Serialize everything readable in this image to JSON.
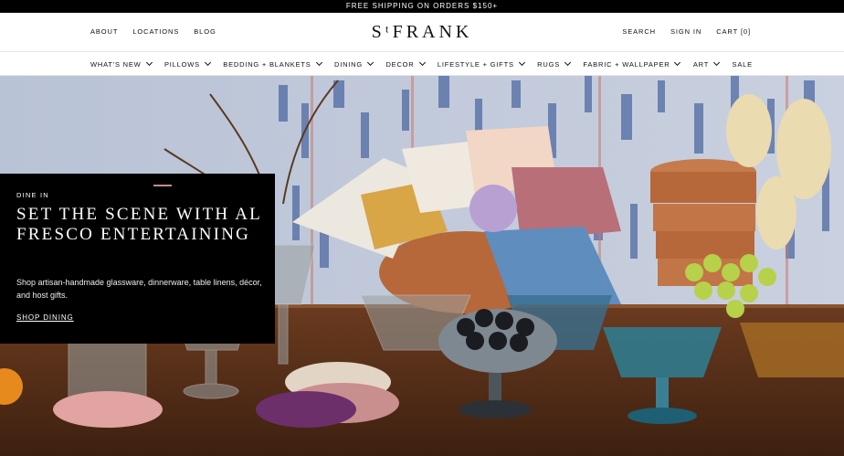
{
  "announcement": {
    "text": "FREE SHIPPING ON ORDERS $150+"
  },
  "header": {
    "left_links": [
      "ABOUT",
      "LOCATIONS",
      "BLOG"
    ],
    "logo": "ST.FRANK",
    "logo_display": "SᵗFRANK",
    "right_links": [
      "SEARCH",
      "SIGN IN",
      "CART [0]"
    ]
  },
  "nav": {
    "items": [
      {
        "label": "WHAT'S NEW",
        "dropdown": true
      },
      {
        "label": "PILLOWS",
        "dropdown": true
      },
      {
        "label": "BEDDING + BLANKETS",
        "dropdown": true
      },
      {
        "label": "DINING",
        "dropdown": true
      },
      {
        "label": "DECOR",
        "dropdown": true
      },
      {
        "label": "LIFESTYLE + GIFTS",
        "dropdown": true
      },
      {
        "label": "RUGS",
        "dropdown": true
      },
      {
        "label": "FABRIC + WALLPAPER",
        "dropdown": true
      },
      {
        "label": "ART",
        "dropdown": true
      },
      {
        "label": "SALE",
        "dropdown": false
      }
    ]
  },
  "hero": {
    "eyebrow": "DINE IN",
    "headline": "SET THE SCENE WITH AL FRESCO ENTERTAINING",
    "description": "Shop artisan-handmade glassware, dinnerware, table linens, décor, and host gifts.",
    "cta": "SHOP DINING",
    "accent_color": "#c98a8a"
  }
}
